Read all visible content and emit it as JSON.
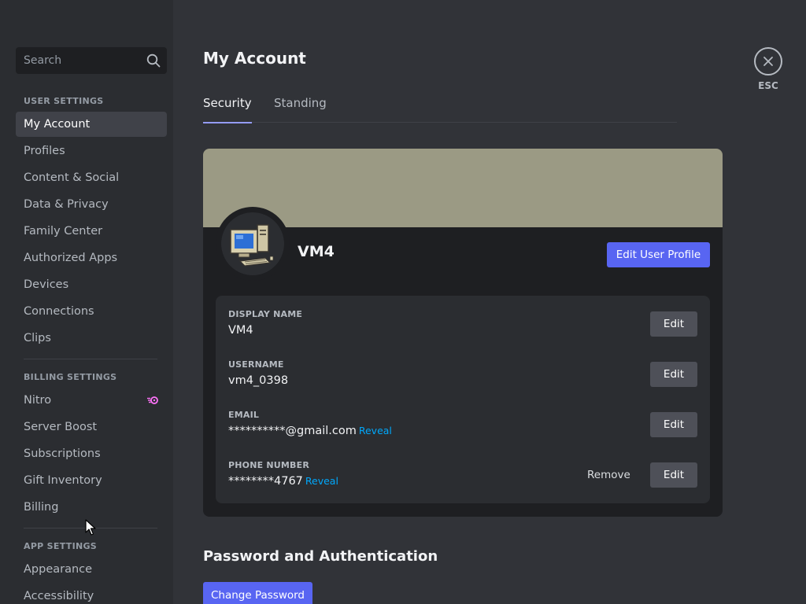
{
  "sidebar": {
    "search_placeholder": "Search",
    "sections": {
      "user": "USER SETTINGS",
      "billing": "BILLING SETTINGS",
      "app": "APP SETTINGS"
    },
    "user_items": [
      "My Account",
      "Profiles",
      "Content & Social",
      "Data & Privacy",
      "Family Center",
      "Authorized Apps",
      "Devices",
      "Connections",
      "Clips"
    ],
    "billing_items": [
      "Nitro",
      "Server Boost",
      "Subscriptions",
      "Gift Inventory",
      "Billing"
    ],
    "app_items": [
      "Appearance",
      "Accessibility"
    ],
    "active_item": "My Account"
  },
  "header": {
    "title": "My Account",
    "tabs": [
      "Security",
      "Standing"
    ],
    "active_tab": "Security",
    "esc_label": "ESC"
  },
  "profile": {
    "banner_color": "#9b9a84",
    "name": "VM4",
    "edit_profile_label": "Edit User Profile",
    "fields": {
      "display_name": {
        "label": "DISPLAY NAME",
        "value": "VM4",
        "edit": "Edit"
      },
      "username": {
        "label": "USERNAME",
        "value": "vm4_0398",
        "edit": "Edit"
      },
      "email": {
        "label": "EMAIL",
        "value": "**********@gmail.com",
        "reveal": "Reveal",
        "edit": "Edit"
      },
      "phone": {
        "label": "PHONE NUMBER",
        "value": "********4767",
        "reveal": "Reveal",
        "remove": "Remove",
        "edit": "Edit"
      }
    }
  },
  "password_section": {
    "title": "Password and Authentication",
    "change_password_label": "Change Password"
  },
  "colors": {
    "accent": "#5865f2",
    "link": "#00a8fc",
    "nitro": "#ff73fa"
  }
}
